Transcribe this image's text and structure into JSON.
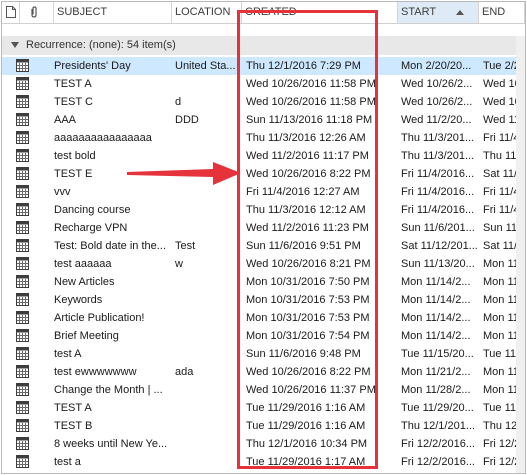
{
  "columns": {
    "subject": "SUBJECT",
    "location": "LOCATION",
    "created": "CREATED",
    "start": "START",
    "end": "END"
  },
  "group": {
    "label": "Recurrence: (none): 54 item(s)"
  },
  "annotation": {
    "arrow_color": "#e5323b",
    "highlight_color": "#e5323b"
  },
  "rows": [
    {
      "subject": "Presidents' Day",
      "location": "United Sta...",
      "created": "Thu 12/1/2016 7:29 PM",
      "start": "Mon 2/20/20...",
      "end": "Tue 2/21/2..."
    },
    {
      "subject": "TEST A",
      "location": "",
      "created": "Wed 10/26/2016 11:58 PM",
      "start": "Wed 10/26/2...",
      "end": "Wed 10/26/..."
    },
    {
      "subject": "TEST C",
      "location": "d",
      "created": "Wed 10/26/2016 11:58 PM",
      "start": "Wed 10/26/2...",
      "end": "Wed 10/26/..."
    },
    {
      "subject": "AAA",
      "location": "DDD",
      "created": "Sun 11/13/2016 11:18 PM",
      "start": "Wed 11/2/20...",
      "end": "Wed 11/2/2..."
    },
    {
      "subject": "aaaaaaaaaaaaaaaa",
      "location": "",
      "created": "Thu 11/3/2016 12:26 AM",
      "start": "Thu 11/3/201...",
      "end": "Fri 11/4/2..."
    },
    {
      "subject": "test bold",
      "location": "",
      "created": "Wed 11/2/2016 11:17 PM",
      "start": "Thu 11/3/201...",
      "end": "Thu 11/3/2..."
    },
    {
      "subject": "TEST E",
      "location": "",
      "created": "Wed 10/26/2016 8:22 PM",
      "start": "Fri 11/4/2016...",
      "end": "Sat 11/5/2..."
    },
    {
      "subject": "vvv",
      "location": "",
      "created": "Fri 11/4/2016 12:27 AM",
      "start": "Fri 11/4/2016...",
      "end": "Fri 11/4/2..."
    },
    {
      "subject": "Dancing course",
      "location": "",
      "created": "Thu 11/3/2016 12:12 AM",
      "start": "Fri 11/4/2016...",
      "end": "Fri 11/4/2..."
    },
    {
      "subject": "Recharge VPN",
      "location": "",
      "created": "Wed 11/2/2016 11:23 PM",
      "start": "Sun 11/6/201...",
      "end": "Sun 11/6/2..."
    },
    {
      "subject": "Test: Bold date in the...",
      "location": "Test",
      "created": "Sun 11/6/2016 9:51 PM",
      "start": "Sat 11/12/201...",
      "end": "Sat 11/12/2..."
    },
    {
      "subject": "test      aaaaaa",
      "location": "w",
      "created": "Wed 10/26/2016 8:21 PM",
      "start": "Sun 11/13/20...",
      "end": "Mon 11/14/..."
    },
    {
      "subject": "New Articles",
      "location": "",
      "created": "Mon 10/31/2016 7:50 PM",
      "start": "Mon 11/14/2...",
      "end": "Mon 11/14/..."
    },
    {
      "subject": "Keywords",
      "location": "",
      "created": "Mon 10/31/2016 7:53 PM",
      "start": "Mon 11/14/2...",
      "end": "Mon 11/14/..."
    },
    {
      "subject": "Article Publication!",
      "location": "",
      "created": "Mon 10/31/2016 7:53 PM",
      "start": "Mon 11/14/2...",
      "end": "Mon 11/14/..."
    },
    {
      "subject": "Brief Meeting",
      "location": "",
      "created": "Mon 10/31/2016 7:54 PM",
      "start": "Mon 11/14/2...",
      "end": "Mon 11/14/..."
    },
    {
      "subject": "test A",
      "location": "",
      "created": "Sun 11/6/2016 9:48 PM",
      "start": "Tue 11/15/20...",
      "end": "Tue 11/15/..."
    },
    {
      "subject": "test ewwwwwww",
      "location": "ada",
      "created": "Wed 10/26/2016 8:22 PM",
      "start": "Mon 11/21/2...",
      "end": "Mon 11/21/..."
    },
    {
      "subject": "Change the Month | ...",
      "location": "",
      "created": "Wed 10/26/2016 11:37 PM",
      "start": "Mon 11/28/2...",
      "end": "Mon 11/28/..."
    },
    {
      "subject": "TEST A",
      "location": "",
      "created": "Tue 11/29/2016 1:16 AM",
      "start": "Tue 11/29/20...",
      "end": "Tue 11/29/..."
    },
    {
      "subject": "TEST B",
      "location": "",
      "created": "Tue 11/29/2016 1:16 AM",
      "start": "Thu 12/1/201...",
      "end": "Thu 12/1/2..."
    },
    {
      "subject": "8 weeks until New Ye...",
      "location": "",
      "created": "Thu 12/1/2016 10:34 PM",
      "start": "Fri 12/2/2016...",
      "end": "Fri 12/2/2..."
    },
    {
      "subject": "test a",
      "location": "",
      "created": "Tue 11/29/2016 1:17 AM",
      "start": "Fri 12/2/2016...",
      "end": "Fri 12/2/2..."
    }
  ]
}
